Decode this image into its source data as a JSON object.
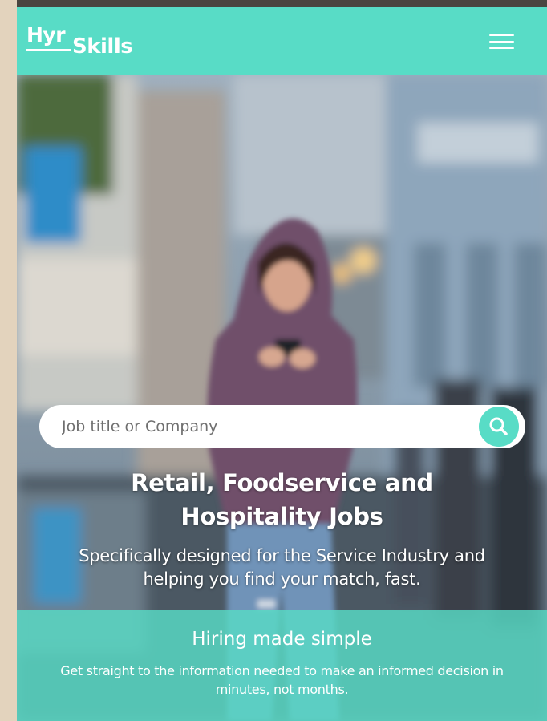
{
  "header": {
    "logo_part1": "Hyr",
    "logo_part2": "Skills",
    "menu_icon": "hamburger-menu-icon"
  },
  "search": {
    "placeholder": "Job title or Company",
    "value": "",
    "button_icon": "search-icon"
  },
  "hero": {
    "headline_line1": "Retail, Foodservice and",
    "headline_line2": "Hospitality Jobs",
    "subheadline_line1": "Specifically designed for the Service Industry and",
    "subheadline_line2": "helping you find your match, fast."
  },
  "feature": {
    "title": "Hiring made simple",
    "text_line1": "Get straight to the information needed to make an informed decision in",
    "text_line2": "minutes, not months."
  },
  "colors": {
    "brand_teal": "#58dcc6",
    "page_background": "#e3d3bd",
    "text_on_brand": "#ffffff"
  }
}
